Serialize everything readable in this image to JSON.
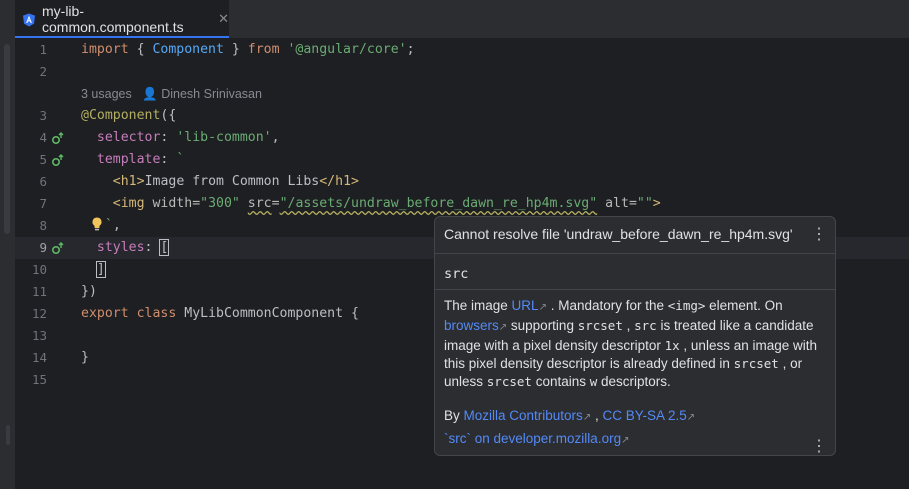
{
  "tab": {
    "title": "my-lib-common.component.ts",
    "close": "✕"
  },
  "gutter": {
    "lines": [
      "1",
      "2",
      "3",
      "4",
      "5",
      "6",
      "7",
      "8",
      "9",
      "10",
      "11",
      "12",
      "13",
      "14",
      "15"
    ]
  },
  "code": {
    "l1": {
      "kw1": "import",
      "p1": " { ",
      "id": "Component",
      "p2": " } ",
      "kw2": "from",
      "sp": " ",
      "str": "'@angular/core'",
      "semi": ";"
    },
    "hint": {
      "usages": "3 usages",
      "author": "Dinesh Srinivasan"
    },
    "l3": {
      "anno": "@Component",
      "p": "({"
    },
    "l4": {
      "prop": "selector",
      "p": ": ",
      "str": "'lib-common'",
      "c": ","
    },
    "l5": {
      "prop": "template",
      "p": ": ",
      "str": "`"
    },
    "l6": {
      "lt": "<",
      "tag": "h1",
      "gt": ">",
      "text": "Image from Common Libs",
      "lt2": "</",
      "tag2": "h1",
      "gt2": ">"
    },
    "l7": {
      "lt": "<",
      "tag": "img",
      "a1": " width",
      "eq1": "=",
      "v1": "\"300\"",
      "a2": "src",
      "eq2": "=",
      "v2": "\"/assets/undraw_before_dawn_re_hp4m.svg\"",
      "a3": " alt",
      "eq3": "=",
      "v3": "\"\"",
      "gt": ">"
    },
    "l8": {
      "str": "`",
      "c": ","
    },
    "l9": {
      "prop": "styles",
      "p": ": ",
      "br": "["
    },
    "l10": {
      "br": "]"
    },
    "l11": {
      "t": "})"
    },
    "l12": {
      "kw1": "export",
      "kw2": "class",
      "cls": "MyLibCommonComponent",
      "p": " {"
    },
    "l14": {
      "t": "}"
    }
  },
  "popup": {
    "title": "Cannot resolve file 'undraw_before_dawn_re_hp4m.svg'",
    "more": "⋮",
    "attr_name": "src",
    "body": {
      "t1": "The image ",
      "url": "URL",
      "t2": " . Mandatory for the ",
      "code_img": "<img>",
      "t3": " element. On ",
      "browsers": "browsers",
      "t4": " supporting ",
      "code_srcset": "srcset",
      "t5": " , ",
      "code_src": "src",
      "t6": " is treated like a candidate image with a pixel density descriptor ",
      "code_1x": "1x",
      "t7": " , unless an image with this pixel density descriptor is already defined in ",
      "code_srcset2": "srcset",
      "t8": " , or unless ",
      "code_srcset3": "srcset",
      "t9": " contains ",
      "code_w": "w",
      "t10": " descriptors."
    },
    "by": "By ",
    "contrib": "Mozilla Contributors",
    "sep": " , ",
    "license": "CC BY-SA 2.5",
    "mdn": "`src` on developer.mozilla.org",
    "ext_arrow": "↗"
  },
  "colors": {
    "accent": "#3574f0",
    "link": "#548af7",
    "angular": "#dd0031"
  }
}
